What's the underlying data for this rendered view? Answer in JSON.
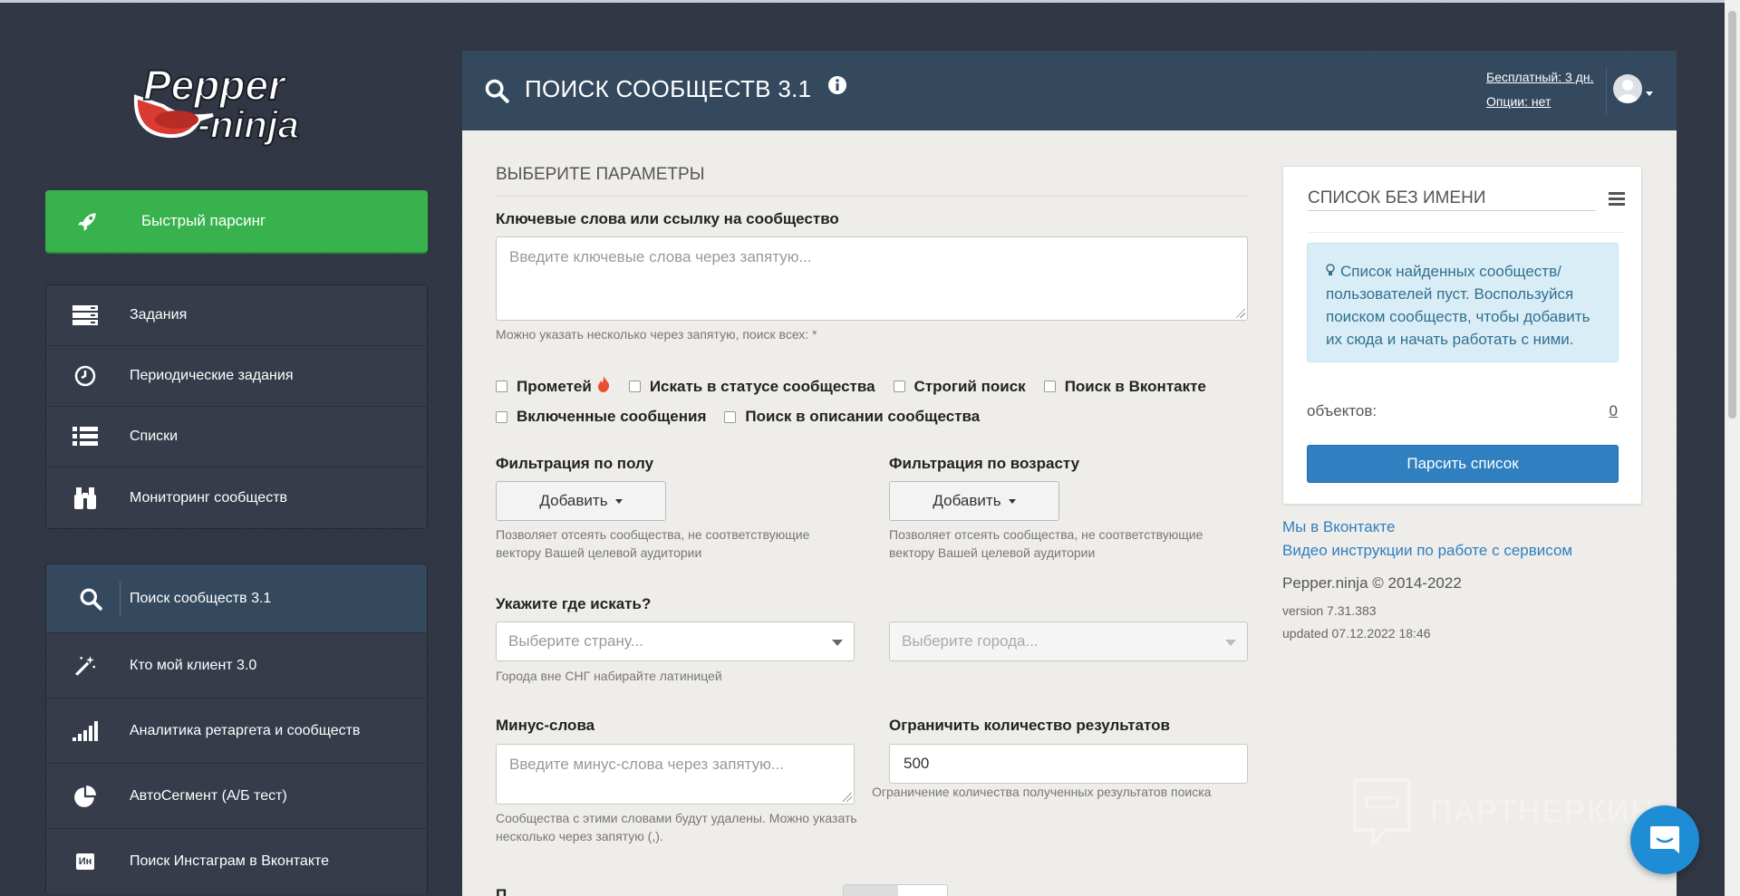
{
  "app": {
    "logo_text": "Pepper ninja",
    "brand_colors": {
      "sidebar_bg": "#2f3542",
      "header_bg": "#34495e",
      "quick_green": "#37b24d",
      "link_blue": "#2f7fc1"
    }
  },
  "sidebar": {
    "quick_parse": {
      "label": "Быстрый парсинг",
      "icon": "rocket-icon"
    },
    "group1": [
      {
        "label": "Задания",
        "icon": "tasks-icon"
      },
      {
        "label": "Периодические задания",
        "icon": "clock-icon"
      },
      {
        "label": "Списки",
        "icon": "list-icon"
      },
      {
        "label": "Мониторинг сообществ",
        "icon": "binoculars-icon"
      }
    ],
    "group2": [
      {
        "label": "Поиск сообществ 3.1",
        "icon": "search-icon",
        "active": true
      },
      {
        "label": "Кто мой клиент 3.0",
        "icon": "magic-wand-icon"
      },
      {
        "label": "Аналитика ретаргета и сообществ",
        "icon": "signal-bars-icon"
      },
      {
        "label": "АвтоСегмент (А/Б тест)",
        "icon": "pie-chart-icon"
      },
      {
        "label": "Поиск Инстаграм в Вконтакте",
        "icon": "instagram-vk-icon",
        "icon_text": "Ин"
      }
    ]
  },
  "header": {
    "title": "ПОИСК СООБЩЕСТВ 3.1",
    "trial": "Бесплатный: 3 дн.",
    "options": "Опции: нет"
  },
  "form": {
    "section_title": "ВЫБЕРИТЕ ПАРАМЕТРЫ",
    "keywords": {
      "label": "Ключевые слова или ссылку на сообщество",
      "placeholder": "Введите ключевые слова через запятую...",
      "help": "Можно указать несколько через запятую, поиск всех: *"
    },
    "checkboxes_row1": [
      "Прометей",
      "Искать в статусе сообщества",
      "Строгий поиск",
      "Поиск в Вконтакте"
    ],
    "checkboxes_row2": [
      "Включенные сообщения",
      "Поиск в описании сообщества"
    ],
    "gender": {
      "label": "Фильтрация по полу",
      "button": "Добавить",
      "help": "Позволяет отсеять сообщества, не соответствующие вектору Вашей целевой аудитории"
    },
    "age": {
      "label": "Фильтрация по возрасту",
      "button": "Добавить",
      "help": "Позволяет отсеять сообщества, не соответствующие вектору Вашей целевой аудитории"
    },
    "location": {
      "label": "Укажите где искать?",
      "country_placeholder": "Выберите страну...",
      "city_placeholder": "Выберите города...",
      "help": "Города вне СНГ набирайте латиницей"
    },
    "minus": {
      "label": "Минус-слова",
      "placeholder": "Введите минус-слова через запятую...",
      "help": "Сообщества с этими словами будут удалены. Можно указать несколько через запятую (,)."
    },
    "limit": {
      "label": "Ограничить количество результатов",
      "value": "500",
      "help": "Ограничение количества полученных результатов поиска"
    },
    "bottom_label": "П"
  },
  "list_card": {
    "title": "СПИСОК БЕЗ ИМЕНИ",
    "notice": "Список найденных сообществ/пользователей пуст. Воспользуйся поиском сообществ, чтобы добавить их сюда и начать работать с ними.",
    "count_label": "объектов:",
    "count_value": "0",
    "parse_button": "Парсить список"
  },
  "footer": {
    "link_vk": "Мы в Вконтакте",
    "link_video": "Видео инструкции по работе с сервисом",
    "copyright": "Pepper.ninja © 2014-2022",
    "version": "version 7.31.383",
    "updated": "updated 07.12.2022 18:46"
  },
  "watermark": "ПАРТНЕРКИН"
}
